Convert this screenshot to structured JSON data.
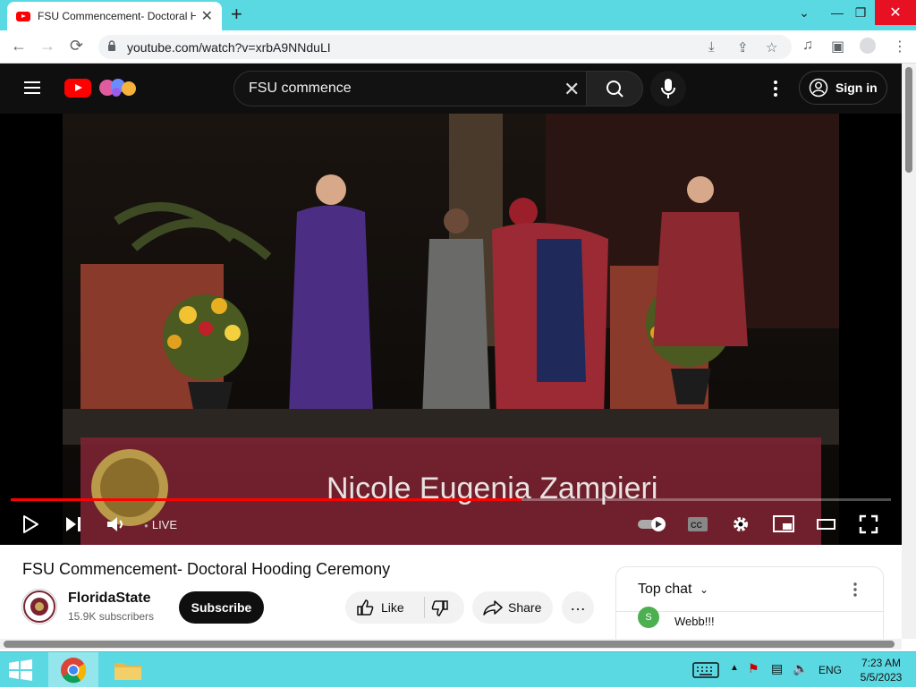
{
  "browser": {
    "tab_title": "FSU Commencement- Doctoral Hooding Ceremony - YouTube",
    "url": "youtube.com/watch?v=xrbA9NNduLI"
  },
  "youtube": {
    "search_query": "FSU commence",
    "sign_in_label": "Sign in"
  },
  "player": {
    "live_label": "LIVE",
    "lower_third_name": "Nicole Eugenia Zampieri",
    "progress_fraction": 0.58
  },
  "video": {
    "title": "FSU Commencement- Doctoral Hooding Ceremony",
    "channel_name": "FloridaState",
    "subscribers": "15.9K subscribers",
    "subscribe_label": "Subscribe",
    "like_label": "Like",
    "share_label": "Share"
  },
  "chat": {
    "title": "Top chat",
    "message": "Webb!!!",
    "avatar_letter": "S"
  },
  "taskbar": {
    "language": "ENG",
    "time": "7:23 AM",
    "date": "5/5/2023"
  },
  "colors": {
    "youtube_red": "#ff0000",
    "tab_strip": "#5bd9e3",
    "fsu_garnet": "#7a2331"
  }
}
